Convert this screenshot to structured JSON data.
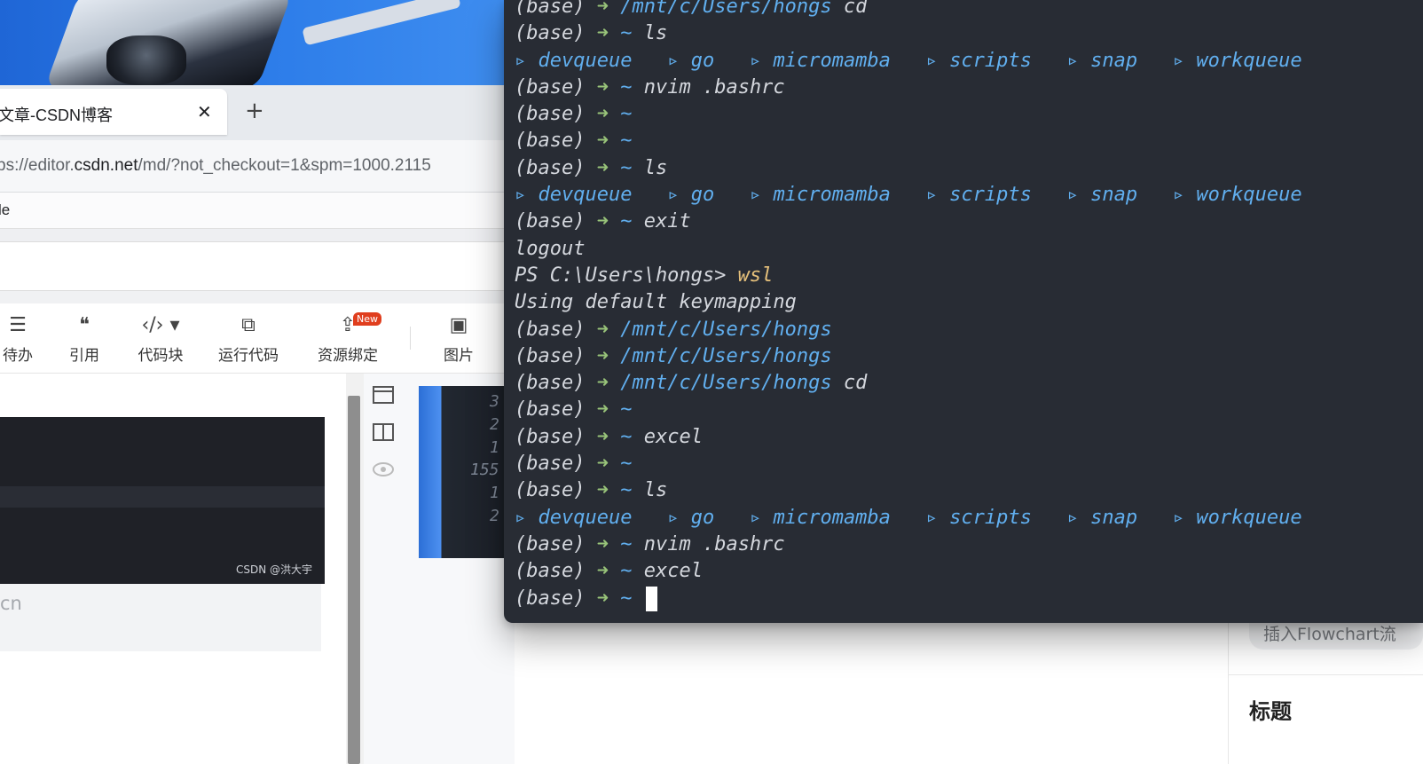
{
  "browser": {
    "tab_title": "文章-CSDN博客",
    "tab_close": "✕",
    "new_tab": "+",
    "url_scheme": "ps://editor.",
    "url_host": "csdn.net",
    "url_path": "/md/?not_checkout=1&spm=1000.2115",
    "bookmark": "le"
  },
  "toolbar": {
    "items": [
      {
        "label": "待办",
        "icon": "☰"
      },
      {
        "label": "引用",
        "icon": "❝"
      },
      {
        "label": "代码块",
        "icon": "‹/› ▾"
      },
      {
        "label": "运行代码",
        "icon": "⧉"
      },
      {
        "label": "资源绑定",
        "icon": "⇪"
      },
      {
        "label": "图片",
        "icon": "▣"
      }
    ],
    "badge": "New"
  },
  "editor": {
    "watermark": "CSDN @洪大宇",
    "cn_text": "cn",
    "line_numbers": [
      "3",
      "2",
      "1",
      "155",
      "1",
      "2"
    ]
  },
  "right_panel": {
    "flowchart_button": "插入Flowchart流",
    "heading": "标题"
  },
  "terminal": {
    "prompt": "(base)",
    "arrow": "➜",
    "lines": [
      {
        "type": "cmd",
        "dir": "/mnt/c/Users/hongs",
        "cmd": " cd"
      },
      {
        "type": "cmd",
        "dir": "~",
        "cmd": " ls"
      },
      {
        "type": "ls",
        "items": [
          "devqueue",
          "go",
          "micromamba",
          "scripts",
          "snap",
          "workqueue"
        ]
      },
      {
        "type": "cmd",
        "dir": "~",
        "cmd": " nvim .bashrc"
      },
      {
        "type": "cmd",
        "dir": "~",
        "cmd": ""
      },
      {
        "type": "cmd",
        "dir": "~",
        "cmd": ""
      },
      {
        "type": "cmd",
        "dir": "~",
        "cmd": " ls"
      },
      {
        "type": "ls",
        "items": [
          "devqueue",
          "go",
          "micromamba",
          "scripts",
          "snap",
          "workqueue"
        ]
      },
      {
        "type": "cmd",
        "dir": "~",
        "cmd": " exit"
      },
      {
        "type": "text",
        "text": "logout"
      },
      {
        "type": "ps",
        "prefix": "PS C:\\Users\\hongs> ",
        "cmd": "wsl"
      },
      {
        "type": "text",
        "text": "Using default keymapping"
      },
      {
        "type": "cmd",
        "dir": "/mnt/c/Users/hongs",
        "cmd": ""
      },
      {
        "type": "cmd",
        "dir": "/mnt/c/Users/hongs",
        "cmd": ""
      },
      {
        "type": "cmd",
        "dir": "/mnt/c/Users/hongs",
        "cmd": " cd"
      },
      {
        "type": "cmd",
        "dir": "~",
        "cmd": ""
      },
      {
        "type": "cmd",
        "dir": "~",
        "cmd": " excel"
      },
      {
        "type": "cmd",
        "dir": "~",
        "cmd": ""
      },
      {
        "type": "cmd",
        "dir": "~",
        "cmd": " ls"
      },
      {
        "type": "ls",
        "items": [
          "devqueue",
          "go",
          "micromamba",
          "scripts",
          "snap",
          "workqueue"
        ]
      },
      {
        "type": "cmd",
        "dir": "~",
        "cmd": " nvim .bashrc"
      },
      {
        "type": "cmd",
        "dir": "~",
        "cmd": " excel"
      },
      {
        "type": "cmd",
        "dir": "~",
        "cmd": "",
        "cursor": true
      }
    ]
  },
  "colors": {
    "terminal_bg": "#282c34",
    "arrow": "#98c379",
    "path": "#61afef",
    "wsl": "#e5c07b"
  }
}
